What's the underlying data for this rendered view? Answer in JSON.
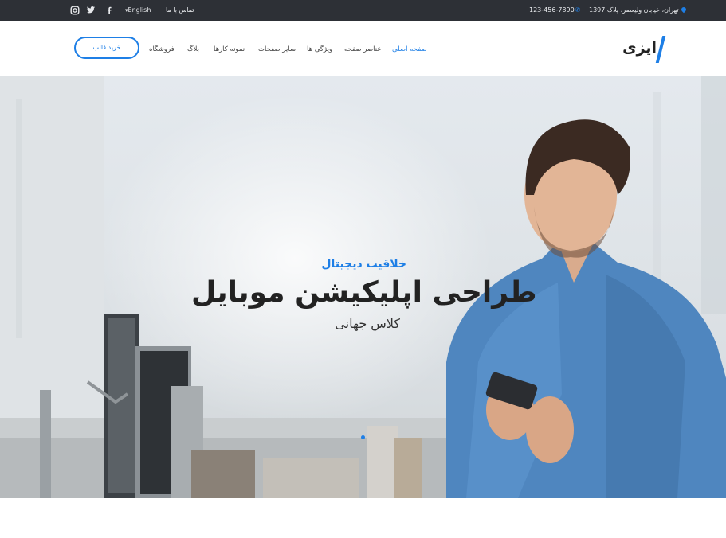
{
  "topbar": {
    "address": "تهران، خیابان ولیعصر، پلاک 1397",
    "phone": "123-456-7890",
    "contact": "تماس با ما",
    "language": "English"
  },
  "header": {
    "logo_text": "ایزی",
    "nav": [
      "صفحه اصلی",
      "عناصر صفحه",
      "ویژگی ها",
      "سایر صفحات",
      "نمونه کارها",
      "بلاگ",
      "فروشگاه"
    ],
    "active_index": 0,
    "buy_button": "خرید قالب"
  },
  "hero": {
    "subtitle": "خلاقیت دیجیتال",
    "title": "طراحی اپلیکیشن موبایل",
    "caption": "کلاس جهانی"
  },
  "colors": {
    "accent": "#1e7fe6",
    "topbar_bg": "#2d3036"
  },
  "icons": [
    "map-pin-icon",
    "phone-icon",
    "chevron-down-icon",
    "facebook-icon",
    "twitter-icon",
    "instagram-icon"
  ]
}
